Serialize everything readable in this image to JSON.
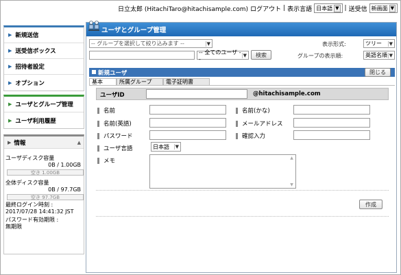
{
  "topbar": {
    "user": "日立太郎 (HitachiTaro@hitachisample.com)",
    "logout": "ログアウト",
    "sep": "|",
    "lang_label": "表示言語",
    "lang_value": "日本語",
    "send_label": "送受信",
    "send_value": "新画面"
  },
  "sidebar": {
    "group1": [
      "新規送信",
      "送受信ボックス",
      "招待者設定",
      "オプション"
    ],
    "group2": [
      "ユーザとグループ管理",
      "ユーザ利用履歴"
    ],
    "info": {
      "title": "情報",
      "user_disk_label": "ユーザディスク容量",
      "user_disk_value": "0B / 1.00GB",
      "user_disk_free": "空き 1.00GB",
      "total_disk_label": "全体ディスク容量",
      "total_disk_value": "0B / 97.7GB",
      "total_disk_free": "空き 97.7GB",
      "last_login_label": "最終ログイン時刻 :",
      "last_login_value": "2017/07/28 14:41:32 JST",
      "pw_expiry_label": "パスワード有効期限 :",
      "pw_expiry_value": "無期限"
    }
  },
  "main": {
    "title": "ユーザとグループ管理",
    "group_filter_placeholder": "-- グループを選択して絞り込みます --",
    "user_filter": "-- 全てのユーザ --",
    "search_button": "検索",
    "display_format_label": "表示形式:",
    "display_format_value": "ツリー",
    "group_order_label": "グループの表示順:",
    "group_order_value": "英語名順"
  },
  "new_user": {
    "title": "新規ユーザ",
    "close_button": "閉じる",
    "tabs": [
      "基本",
      "所属グループ",
      "電子証明書"
    ],
    "user_id_label": "ユーザID",
    "domain": "@hitachisample.com",
    "name_label": "名前",
    "name_kana_label": "名前(かな)",
    "name_en_label": "名前(英語)",
    "email_label": "メールアドレス",
    "password_label": "パスワード",
    "confirm_label": "確認入力",
    "user_lang_label": "ユーザ言語",
    "user_lang_value": "日本語",
    "memo_label": "メモ",
    "create_button": "作成"
  },
  "colors": {
    "accent_blue": "#2a75c4",
    "nav_green": "#3a9c3a",
    "panel_header": "#3a73b6"
  }
}
